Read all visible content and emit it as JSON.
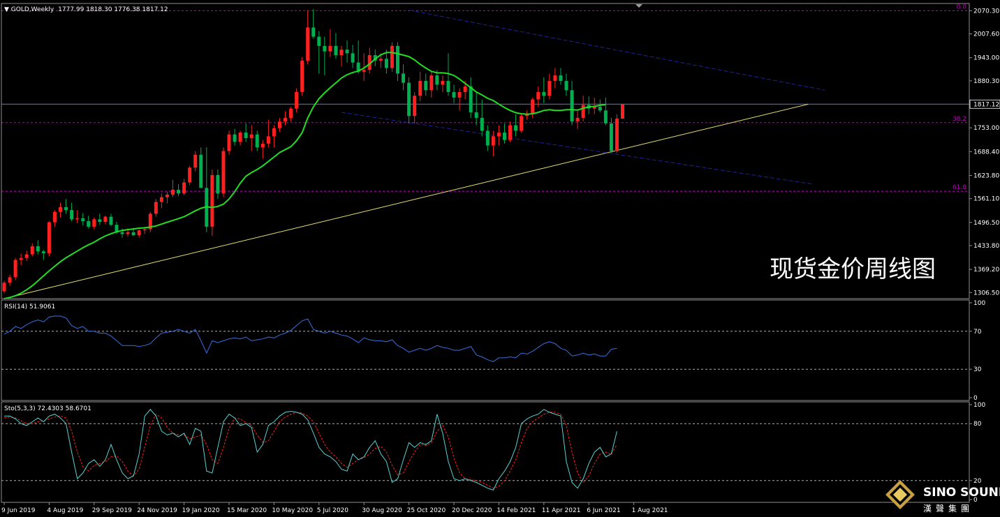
{
  "header": {
    "symbol": "GOLD,Weekly",
    "ohlc": "1777.99 1818.30 1776.38 1817.12"
  },
  "caption": "现货金价周线图",
  "logo": {
    "name": "SINO SOUND",
    "sub": "漢聲集團"
  },
  "colors": {
    "background": "#000000",
    "bull": "#ff2020",
    "bear": "#00b050",
    "ma": "#22dd22",
    "rsi": "#3b6fe0",
    "sto_main": "#5ad2d2",
    "sto_signal": "#ff2020",
    "fib": "#c000c0",
    "trend": "#e8e070",
    "channel": "#20209a",
    "level": "#6a7ab0",
    "grid": "#909090",
    "dashed": "#b0b0b0",
    "text": "#ffffff"
  },
  "chart_data": [
    {
      "type": "candlestick",
      "title": "GOLD,Weekly",
      "ylim": [
        1290,
        2090
      ],
      "y_ticks": [
        "2070.30",
        "2007.60",
        "1943.00",
        "1880.30",
        "1817.12",
        "1753.00",
        "1688.40",
        "1623.80",
        "1561.10",
        "1496.50",
        "1433.80",
        "1369.20",
        "1306.50"
      ],
      "y_tick_values": [
        2070.3,
        2007.6,
        1943.0,
        1880.3,
        1817.12,
        1753.0,
        1688.4,
        1623.8,
        1561.1,
        1496.5,
        1433.8,
        1369.2,
        1306.5
      ],
      "x_ticks": [
        "9 Jun 2019",
        "4 Aug 2019",
        "29 Sep 2019",
        "24 Nov 2019",
        "19 Jan 2020",
        "15 Mar 2020",
        "10 May 2020",
        "5 Jul 2020",
        "30 Aug 2020",
        "25 Oct 2020",
        "20 Dec 2020",
        "14 Feb 2021",
        "11 Apr 2021",
        "6 Jun 2021",
        "1 Aug 2021"
      ],
      "x_tick_index": [
        0,
        8,
        16,
        24,
        32,
        40,
        48,
        56,
        64,
        72,
        80,
        88,
        96,
        104,
        112
      ],
      "current_price": "1817.12",
      "current_value": 1817.12,
      "fib_levels": [
        {
          "label": "0.0",
          "value": 2070.3
        },
        {
          "label": "38.2",
          "value": 1767.0
        },
        {
          "label": "61.8",
          "value": 1581.0
        }
      ],
      "ma_label": "",
      "ma": [
        1290,
        1293,
        1298,
        1305,
        1314,
        1325,
        1338,
        1352,
        1365,
        1378,
        1390,
        1401,
        1410,
        1419,
        1428,
        1436,
        1443,
        1452,
        1460,
        1466,
        1471,
        1475,
        1477,
        1479,
        1481,
        1482,
        1484,
        1487,
        1492,
        1497,
        1502,
        1507,
        1512,
        1520,
        1528,
        1535,
        1539,
        1537,
        1540,
        1546,
        1560,
        1580,
        1603,
        1622,
        1632,
        1640,
        1650,
        1662,
        1674,
        1686,
        1694,
        1702,
        1718,
        1740,
        1780,
        1810,
        1832,
        1848,
        1862,
        1875,
        1888,
        1897,
        1903,
        1907,
        1915,
        1926,
        1940,
        1951,
        1957,
        1957,
        1954,
        1950,
        1946,
        1937,
        1925,
        1915,
        1906,
        1902,
        1902,
        1900,
        1895,
        1885,
        1873,
        1862,
        1850,
        1842,
        1833,
        1827,
        1817,
        1808,
        1800,
        1794,
        1791,
        1790,
        1791,
        1795,
        1800,
        1802,
        1800,
        1800,
        1802,
        1802,
        1801,
        1806,
        1810,
        1811,
        1814,
        1816
      ],
      "candles": [
        [
          1310,
          1338,
          1305,
          1333
        ],
        [
          1333,
          1355,
          1325,
          1348
        ],
        [
          1348,
          1400,
          1340,
          1395
        ],
        [
          1395,
          1412,
          1380,
          1400
        ],
        [
          1400,
          1420,
          1392,
          1410
        ],
        [
          1410,
          1440,
          1405,
          1432
        ],
        [
          1432,
          1448,
          1410,
          1418
        ],
        [
          1418,
          1422,
          1395,
          1413
        ],
        [
          1413,
          1500,
          1405,
          1497
        ],
        [
          1497,
          1530,
          1485,
          1525
        ],
        [
          1525,
          1550,
          1510,
          1538
        ],
        [
          1538,
          1560,
          1520,
          1530
        ],
        [
          1530,
          1550,
          1500,
          1505
        ],
        [
          1505,
          1530,
          1495,
          1508
        ],
        [
          1508,
          1522,
          1488,
          1500
        ],
        [
          1500,
          1515,
          1480,
          1485
        ],
        [
          1485,
          1510,
          1478,
          1505
        ],
        [
          1505,
          1520,
          1490,
          1498
        ],
        [
          1498,
          1515,
          1492,
          1512
        ],
        [
          1512,
          1520,
          1486,
          1490
        ],
        [
          1490,
          1498,
          1465,
          1470
        ],
        [
          1470,
          1480,
          1455,
          1465
        ],
        [
          1465,
          1480,
          1458,
          1470
        ],
        [
          1470,
          1482,
          1460,
          1462
        ],
        [
          1462,
          1478,
          1455,
          1475
        ],
        [
          1475,
          1485,
          1465,
          1478
        ],
        [
          1478,
          1525,
          1470,
          1520
        ],
        [
          1520,
          1560,
          1512,
          1552
        ],
        [
          1552,
          1575,
          1535,
          1565
        ],
        [
          1565,
          1580,
          1548,
          1572
        ],
        [
          1572,
          1612,
          1565,
          1585
        ],
        [
          1585,
          1600,
          1568,
          1575
        ],
        [
          1575,
          1615,
          1570,
          1605
        ],
        [
          1605,
          1650,
          1598,
          1645
        ],
        [
          1645,
          1690,
          1635,
          1680
        ],
        [
          1680,
          1700,
          1600,
          1590
        ],
        [
          1590,
          1700,
          1470,
          1485
        ],
        [
          1485,
          1640,
          1460,
          1625
        ],
        [
          1625,
          1640,
          1560,
          1575
        ],
        [
          1575,
          1700,
          1565,
          1690
        ],
        [
          1690,
          1745,
          1680,
          1735
        ],
        [
          1735,
          1750,
          1705,
          1715
        ],
        [
          1715,
          1745,
          1705,
          1740
        ],
        [
          1740,
          1765,
          1715,
          1725
        ],
        [
          1725,
          1760,
          1690,
          1735
        ],
        [
          1735,
          1745,
          1690,
          1700
        ],
        [
          1700,
          1720,
          1670,
          1710
        ],
        [
          1710,
          1775,
          1700,
          1730
        ],
        [
          1730,
          1760,
          1700,
          1752
        ],
        [
          1752,
          1780,
          1742,
          1770
        ],
        [
          1770,
          1798,
          1760,
          1780
        ],
        [
          1780,
          1810,
          1770,
          1805
        ],
        [
          1805,
          1860,
          1795,
          1850
        ],
        [
          1850,
          1945,
          1840,
          1935
        ],
        [
          1935,
          2072,
          1925,
          2025
        ],
        [
          2025,
          2075,
          1995,
          2000
        ],
        [
          2000,
          2015,
          1900,
          1975
        ],
        [
          1975,
          2000,
          1895,
          1960
        ],
        [
          1960,
          2020,
          1945,
          1975
        ],
        [
          1975,
          2010,
          1940,
          1950
        ],
        [
          1950,
          1975,
          1920,
          1965
        ],
        [
          1965,
          1990,
          1930,
          1955
        ],
        [
          1955,
          1978,
          1915,
          1930
        ],
        [
          1930,
          1990,
          1900,
          1905
        ],
        [
          1905,
          1955,
          1880,
          1910
        ],
        [
          1910,
          1970,
          1900,
          1950
        ],
        [
          1950,
          1965,
          1920,
          1935
        ],
        [
          1935,
          1955,
          1915,
          1940
        ],
        [
          1940,
          1965,
          1900,
          1915
        ],
        [
          1915,
          1985,
          1905,
          1975
        ],
        [
          1975,
          1985,
          1880,
          1900
        ],
        [
          1900,
          1925,
          1855,
          1875
        ],
        [
          1875,
          1890,
          1765,
          1785
        ],
        [
          1785,
          1850,
          1765,
          1840
        ],
        [
          1840,
          1905,
          1825,
          1880
        ],
        [
          1880,
          1900,
          1840,
          1855
        ],
        [
          1855,
          1905,
          1835,
          1895
        ],
        [
          1895,
          1910,
          1855,
          1870
        ],
        [
          1870,
          1895,
          1850,
          1880
        ],
        [
          1880,
          1955,
          1840,
          1850
        ],
        [
          1850,
          1870,
          1820,
          1835
        ],
        [
          1835,
          1860,
          1800,
          1850
        ],
        [
          1850,
          1880,
          1830,
          1865
        ],
        [
          1865,
          1890,
          1780,
          1795
        ],
        [
          1795,
          1850,
          1760,
          1780
        ],
        [
          1780,
          1830,
          1730,
          1745
        ],
        [
          1745,
          1760,
          1690,
          1705
        ],
        [
          1705,
          1745,
          1675,
          1730
        ],
        [
          1730,
          1760,
          1705,
          1740
        ],
        [
          1740,
          1765,
          1710,
          1720
        ],
        [
          1720,
          1770,
          1715,
          1760
        ],
        [
          1760,
          1790,
          1730,
          1745
        ],
        [
          1745,
          1790,
          1740,
          1785
        ],
        [
          1785,
          1800,
          1775,
          1790
        ],
        [
          1790,
          1835,
          1780,
          1830
        ],
        [
          1830,
          1865,
          1810,
          1850
        ],
        [
          1850,
          1890,
          1820,
          1840
        ],
        [
          1840,
          1900,
          1830,
          1880
        ],
        [
          1880,
          1915,
          1860,
          1895
        ],
        [
          1895,
          1915,
          1870,
          1880
        ],
        [
          1880,
          1900,
          1840,
          1855
        ],
        [
          1855,
          1880,
          1760,
          1770
        ],
        [
          1770,
          1800,
          1750,
          1780
        ],
        [
          1780,
          1840,
          1770,
          1815
        ],
        [
          1815,
          1838,
          1790,
          1805
        ],
        [
          1805,
          1835,
          1790,
          1810
        ],
        [
          1810,
          1830,
          1795,
          1800
        ],
        [
          1800,
          1835,
          1760,
          1765
        ],
        [
          1765,
          1780,
          1685,
          1690
        ],
        [
          1690,
          1790,
          1685,
          1778
        ],
        [
          1777.99,
          1818.3,
          1776.38,
          1817.12
        ]
      ],
      "trendline": [
        [
          0,
          1290
        ],
        [
          143,
          1817
        ]
      ],
      "channel_upper": [
        [
          72,
          2072
        ],
        [
          146,
          1855
        ]
      ],
      "channel_lower": [
        [
          60,
          1795
        ],
        [
          144,
          1600
        ]
      ]
    },
    {
      "type": "line",
      "title": "RSI(14) 51.9061",
      "label": "RSI(14)",
      "value": "51.9061",
      "ylim": [
        0,
        100
      ],
      "y_ticks": [
        "100",
        "70",
        "30",
        "0"
      ],
      "y_tick_values": [
        100,
        70,
        30,
        0
      ],
      "levels": [
        70,
        30
      ],
      "values": [
        67,
        70,
        75,
        73,
        77,
        80,
        82,
        80,
        85,
        86,
        86,
        84,
        76,
        73,
        75,
        70,
        70,
        68,
        68,
        65,
        60,
        55,
        55,
        55,
        54,
        55,
        57,
        63,
        68,
        69,
        70,
        72,
        70,
        68,
        72,
        60,
        47,
        60,
        58,
        60,
        62,
        63,
        62,
        64,
        60,
        61,
        62,
        64,
        63,
        66,
        68,
        71,
        76,
        81,
        83,
        72,
        70,
        68,
        70,
        68,
        66,
        65,
        62,
        58,
        63,
        61,
        60,
        60,
        59,
        61,
        55,
        52,
        48,
        50,
        52,
        50,
        52,
        55,
        53,
        52,
        50,
        50,
        52,
        54,
        45,
        43,
        40,
        38,
        42,
        42,
        43,
        42,
        47,
        46,
        49,
        53,
        57,
        59,
        57,
        52,
        50,
        44,
        45,
        47,
        45,
        46,
        44,
        44,
        51,
        52
      ]
    },
    {
      "type": "line",
      "title": "Sto(5,3,3) 72.4303 58.6701",
      "label": "Sto(5,3,3)",
      "main_value": "72.4303",
      "signal_value": "58.6701",
      "ylim": [
        0,
        100
      ],
      "y_ticks": [
        "100",
        "80",
        "20",
        "0"
      ],
      "y_tick_values": [
        100,
        80,
        20,
        0
      ],
      "levels": [
        80,
        20
      ],
      "series": [
        {
          "values": [
            88,
            88,
            85,
            80,
            78,
            82,
            86,
            82,
            88,
            90,
            86,
            80,
            50,
            22,
            28,
            38,
            42,
            35,
            42,
            58,
            42,
            28,
            22,
            25,
            48,
            88,
            95,
            88,
            72,
            68,
            70,
            66,
            70,
            58,
            75,
            72,
            30,
            28,
            55,
            82,
            90,
            86,
            78,
            80,
            76,
            50,
            58,
            78,
            82,
            88,
            92,
            93,
            92,
            90,
            84,
            70,
            55,
            48,
            45,
            40,
            32,
            30,
            48,
            42,
            45,
            55,
            62,
            48,
            40,
            18,
            22,
            42,
            60,
            55,
            60,
            58,
            62,
            90,
            70,
            40,
            22,
            20,
            22,
            20,
            18,
            15,
            12,
            10,
            22,
            30,
            40,
            55,
            80,
            85,
            88,
            90,
            95,
            92,
            90,
            88,
            40,
            18,
            12,
            22,
            38,
            50,
            55,
            45,
            48,
            72
          ]
        },
        {
          "values": [
            86,
            87,
            86,
            83,
            80,
            80,
            82,
            83,
            85,
            87,
            88,
            86,
            72,
            50,
            35,
            30,
            36,
            38,
            40,
            45,
            46,
            40,
            30,
            25,
            32,
            55,
            78,
            90,
            86,
            76,
            70,
            68,
            68,
            64,
            66,
            68,
            58,
            42,
            38,
            55,
            75,
            86,
            85,
            81,
            78,
            68,
            60,
            62,
            72,
            82,
            87,
            90,
            92,
            91,
            88,
            82,
            70,
            58,
            50,
            45,
            38,
            34,
            38,
            42,
            44,
            48,
            54,
            56,
            50,
            36,
            26,
            28,
            40,
            50,
            58,
            57,
            60,
            72,
            78,
            66,
            44,
            28,
            22,
            21,
            20,
            18,
            15,
            12,
            14,
            20,
            30,
            42,
            60,
            75,
            82,
            86,
            90,
            92,
            92,
            90,
            78,
            50,
            28,
            18,
            25,
            38,
            48,
            50,
            48,
            58
          ]
        }
      ]
    }
  ]
}
